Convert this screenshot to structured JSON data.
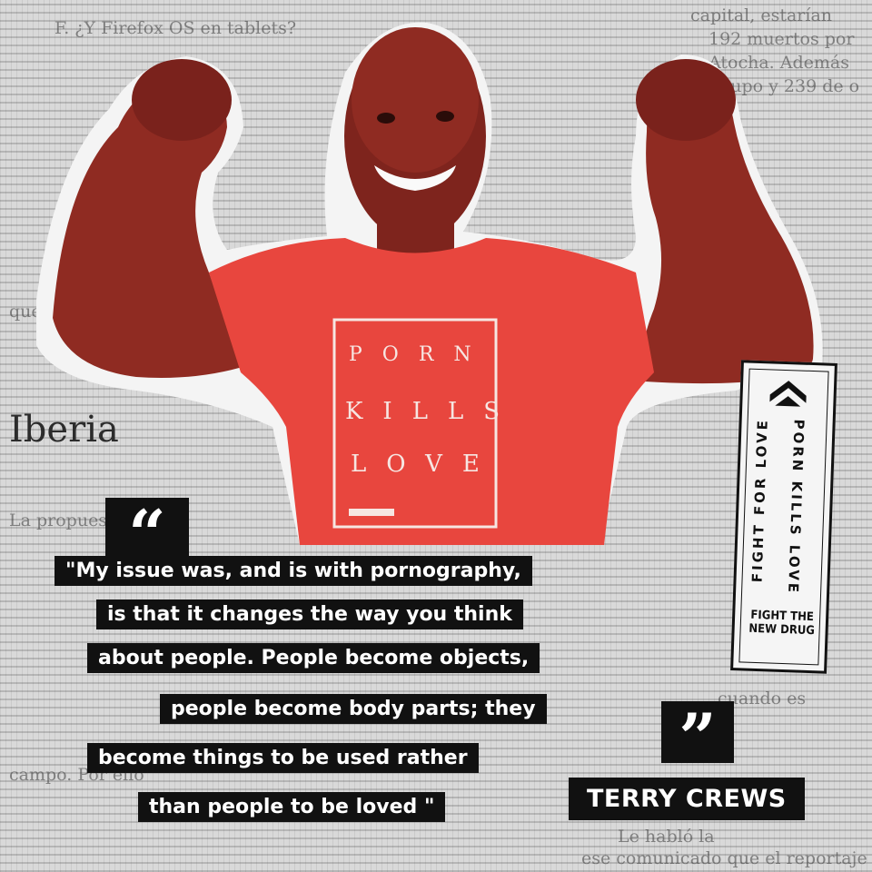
{
  "background": {
    "masthead": "Iberia",
    "snippets": [
      "F. ¿Y Firefox OS en tablets?",
      "capital, estarían",
      "192 muertos por",
      "Atocha. Además",
      "Grupo y 239 de o",
      "que se ven y que",
      "La propuesta de",
      "campo. Por ello",
      "cuando es",
      "Le habló la",
      "ese comunicado que el reportaje"
    ]
  },
  "shirt": {
    "line1": "PORN",
    "line2": "KILLS",
    "line3": "LOVE"
  },
  "badge": {
    "left_text": "FIGHT FOR LOVE",
    "right_text": "PORN KILLS LOVE",
    "brand_line1": "FIGHT THE",
    "brand_line2": "NEW DRUG"
  },
  "quote": {
    "open_mark": "“",
    "close_mark": "”",
    "lines": [
      "\"My issue was, and is with pornography,",
      "is that it changes the way you think",
      "about people. People become objects,",
      "people become body parts; they",
      "become things to be used rather",
      "than people to be loved \""
    ],
    "author": "TERRY CREWS"
  },
  "colors": {
    "shirt_red": "#e8463e",
    "skin": "#8a2a22",
    "label_black": "#111111",
    "paper_gray": "#d9d9d9"
  }
}
